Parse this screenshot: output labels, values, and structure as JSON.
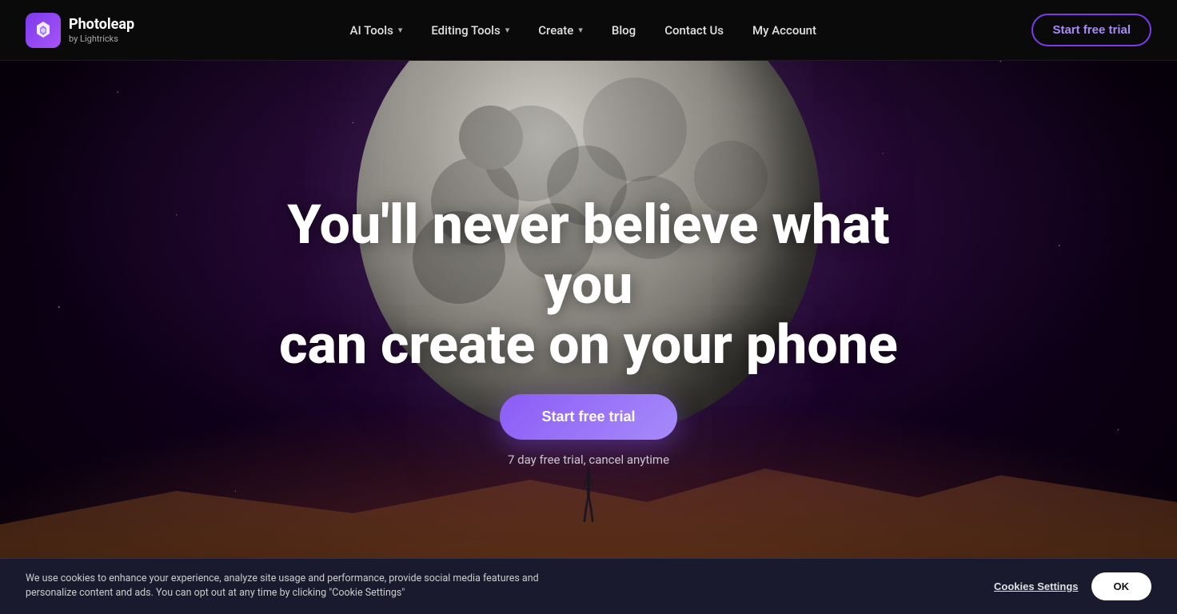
{
  "brand": {
    "name": "Photoleap",
    "sub": "by Lightricks",
    "icon_symbol": "⬡"
  },
  "nav": {
    "links": [
      {
        "id": "ai-tools",
        "label": "AI Tools",
        "has_dropdown": true
      },
      {
        "id": "editing-tools",
        "label": "Editing Tools",
        "has_dropdown": true
      },
      {
        "id": "create",
        "label": "Create",
        "has_dropdown": true
      },
      {
        "id": "blog",
        "label": "Blog",
        "has_dropdown": false
      },
      {
        "id": "contact-us",
        "label": "Contact Us",
        "has_dropdown": false
      },
      {
        "id": "my-account",
        "label": "My Account",
        "has_dropdown": false
      }
    ],
    "cta_label": "Start free trial"
  },
  "hero": {
    "headline_line1": "You'll never believe what you",
    "headline_line2": "can create on your phone",
    "cta_label": "Start free trial",
    "sub_label": "7 day free trial, cancel anytime"
  },
  "cookie": {
    "text": "We use cookies to enhance your experience, analyze site usage and performance, provide social media features and personalize content and ads. You can opt out at any time by clicking \"Cookie Settings\"",
    "settings_label": "Cookies Settings",
    "ok_label": "OK"
  }
}
